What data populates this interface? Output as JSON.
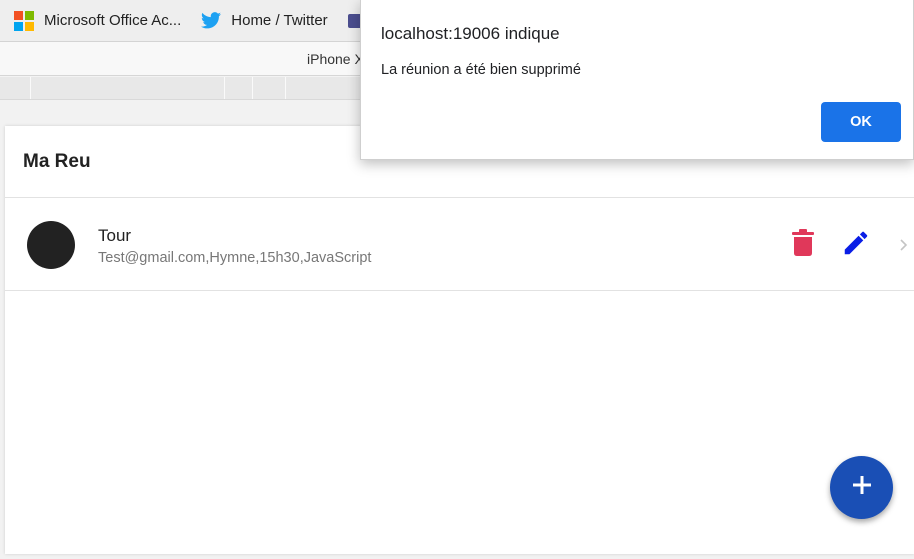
{
  "bookmarks": [
    {
      "label": "Microsoft Office Ac...",
      "icon": "microsoft-logo-icon"
    },
    {
      "label": "Home / Twitter",
      "icon": "twitter-icon"
    },
    {
      "label": "",
      "icon": "bookmark-icon"
    }
  ],
  "device_toolbar": {
    "device_name": "iPhone X"
  },
  "app": {
    "title": "Ma Reu",
    "meetings": [
      {
        "title": "Tour",
        "subtitle": "Test@gmail.com,Hymne,15h30,JavaScript",
        "avatar_color": "#222222"
      }
    ],
    "colors": {
      "delete": "#e0385a",
      "edit": "#0a1ee6",
      "fab": "#1a4fb5"
    },
    "icons": {
      "delete": "trash-icon",
      "edit": "pencil-icon",
      "chevron": "chevron-right-icon",
      "fab": "plus-icon"
    }
  },
  "dialog": {
    "title": "localhost:19006 indique",
    "message": "La réunion a été bien supprimé",
    "ok_label": "OK",
    "ok_color": "#1a73e8"
  }
}
